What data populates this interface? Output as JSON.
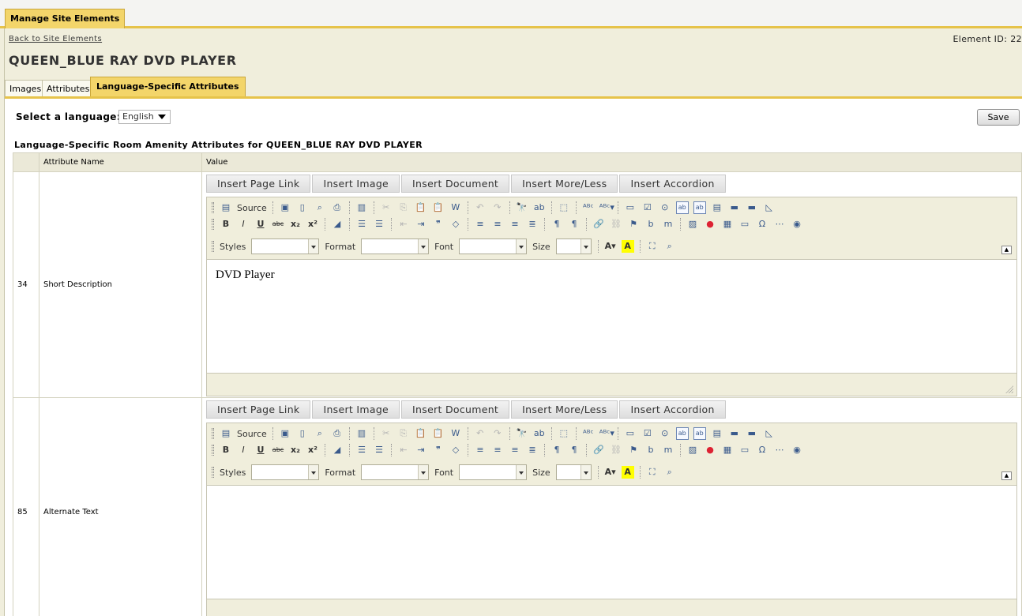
{
  "tab": {
    "label": "Manage Site Elements",
    "close": "⊗"
  },
  "header": {
    "back_link": "Back to Site Elements",
    "element_id": "Element ID: 22",
    "title": "QUEEN_BLUE RAY DVD PLAYER"
  },
  "subtabs": [
    "Images",
    "Attributes",
    "Language-Specific Attributes"
  ],
  "language": {
    "label": "Select a language:",
    "selected": "English"
  },
  "save_label": "Save",
  "section_title": "Language-Specific Room Amenity Attributes for QUEEN_BLUE RAY DVD PLAYER",
  "table": {
    "headers": [
      "",
      "Attribute Name",
      "Value"
    ],
    "rows": [
      {
        "id": "34",
        "name": "Short Description",
        "content": "DVD Player"
      },
      {
        "id": "85",
        "name": "Alternate Text",
        "content": ""
      }
    ]
  },
  "insert_buttons": [
    "Insert Page Link",
    "Insert Image",
    "Insert Document",
    "Insert More/Less",
    "Insert Accordion"
  ],
  "toolbar": {
    "source": "Source",
    "styles": "Styles",
    "format": "Format",
    "font": "Font",
    "size": "Size"
  }
}
